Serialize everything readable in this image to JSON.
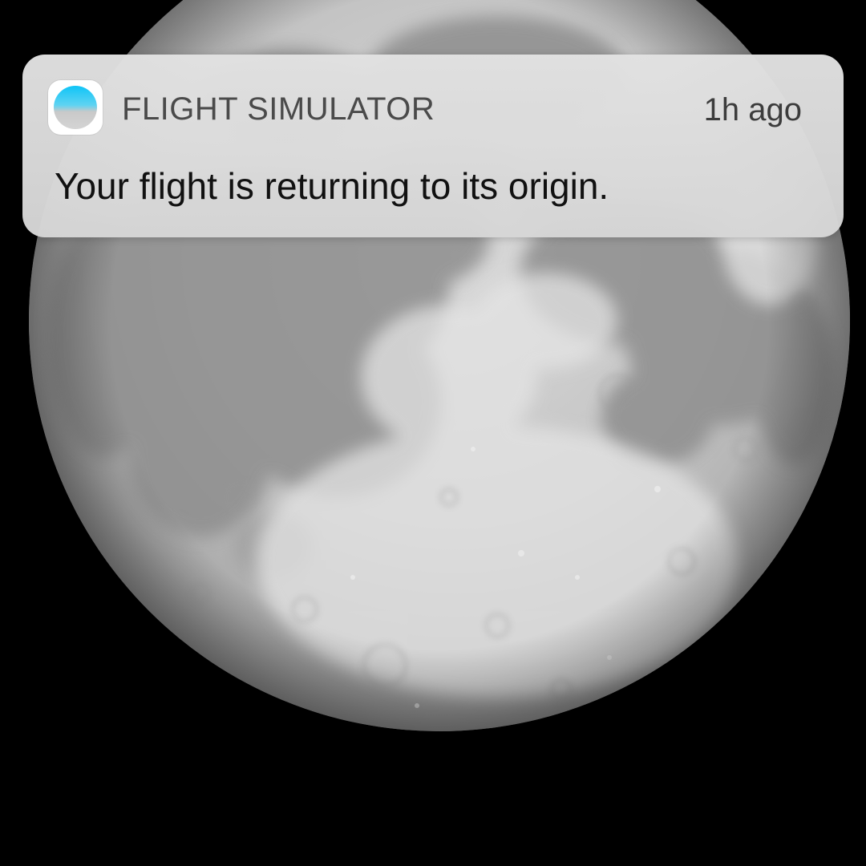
{
  "wallpaper": {
    "subject": "moon",
    "background_color": "#000000"
  },
  "notification": {
    "app_icon": "flight-simulator-app-icon",
    "app_name": "FLIGHT SIMULATOR",
    "timestamp": "1h ago",
    "message": "Your flight is returning to its origin."
  },
  "colors": {
    "icon_sky_top": "#1ec8f5",
    "icon_sky_bottom": "#cfcfcf",
    "card_background": "#dedede",
    "text_primary": "#111111",
    "text_secondary": "#4a4a4a"
  }
}
